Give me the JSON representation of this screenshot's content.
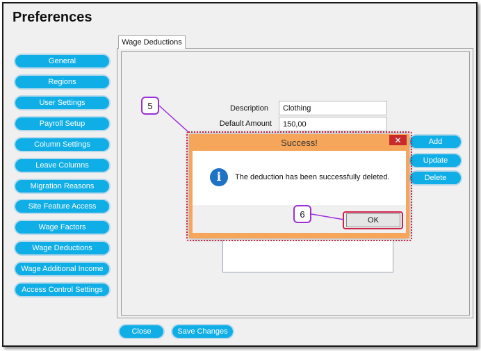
{
  "window": {
    "title": "Preferences"
  },
  "sidebar": {
    "items": [
      {
        "label": "General"
      },
      {
        "label": "Regions"
      },
      {
        "label": "User Settings"
      },
      {
        "label": "Payroll Setup"
      },
      {
        "label": "Column Settings"
      },
      {
        "label": "Leave Columns"
      },
      {
        "label": "Migration Reasons"
      },
      {
        "label": "Site Feature Access"
      },
      {
        "label": "Wage Factors"
      },
      {
        "label": "Wage Deductions"
      },
      {
        "label": "Wage Additional Income"
      },
      {
        "label": "Access Control Settings"
      }
    ]
  },
  "tab": {
    "label": "Wage Deductions"
  },
  "form": {
    "description_label": "Description",
    "description_value": "Clothing",
    "default_amount_label": "Default Amount",
    "default_amount_value": "150,00"
  },
  "actions": {
    "add": "Add",
    "update": "Update",
    "delete": "Delete"
  },
  "footer": {
    "close": "Close",
    "save": "Save Changes"
  },
  "dialog": {
    "title": "Success!",
    "close_glyph": "✕",
    "icon": "info-icon",
    "icon_glyph": "i",
    "message": "The deduction has been successfully deleted.",
    "ok": "OK"
  },
  "callouts": {
    "five": "5",
    "six": "6"
  },
  "colors": {
    "accent": "#10aee6",
    "dialog_title_bg": "#f6a65a",
    "highlight": "#d0214a",
    "callout_border": "#9b30d9"
  }
}
